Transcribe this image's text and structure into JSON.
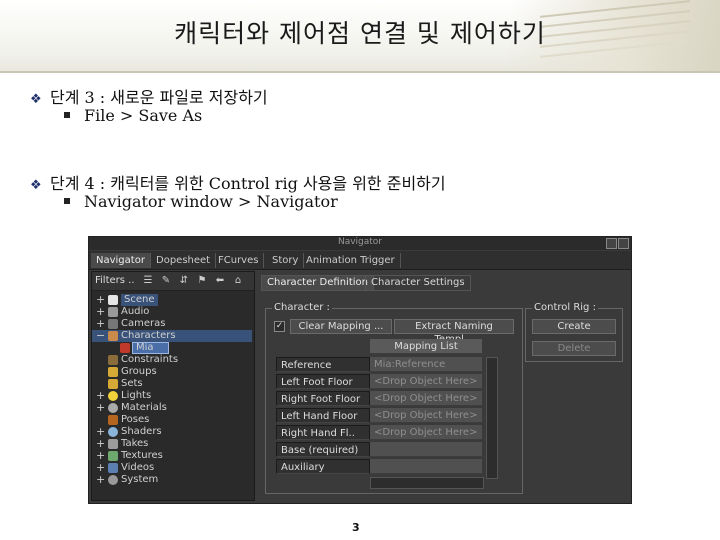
{
  "slide": {
    "title": "캐릭터와 제어점 연결 및 제어하기",
    "bullets": [
      {
        "text": "단계 3 : 새로운 파일로 저장하기",
        "sub": "File > Save As"
      },
      {
        "text": "단계 4 : 캐릭터를 위한 Control rig 사용을 위한 준비하기",
        "sub": "Navigator window > Navigator"
      }
    ],
    "page_number": "3"
  },
  "window": {
    "title": "Navigator",
    "tabs": [
      "Navigator",
      "Dopesheet",
      "FCurves",
      "Story",
      "Animation Trigger"
    ],
    "filters_label": "Filters ..",
    "tree": [
      {
        "label": "Scene",
        "expand": "+"
      },
      {
        "label": "Audio",
        "expand": "+"
      },
      {
        "label": "Cameras",
        "expand": "+"
      },
      {
        "label": "Characters",
        "expand": "−"
      },
      {
        "label": "Mia",
        "expand": ""
      },
      {
        "label": "Constraints",
        "expand": ""
      },
      {
        "label": "Groups",
        "expand": ""
      },
      {
        "label": "Sets",
        "expand": ""
      },
      {
        "label": "Lights",
        "expand": "+"
      },
      {
        "label": "Materials",
        "expand": "+"
      },
      {
        "label": "Poses",
        "expand": ""
      },
      {
        "label": "Shaders",
        "expand": "+"
      },
      {
        "label": "Takes",
        "expand": "+"
      },
      {
        "label": "Textures",
        "expand": "+"
      },
      {
        "label": "Videos",
        "expand": "+"
      },
      {
        "label": "System",
        "expand": "+"
      }
    ],
    "right_tabs": [
      "Character Definition",
      "Character Settings"
    ],
    "character_group": "Character :",
    "clear_mapping": "Clear Mapping ...",
    "extract_naming": "Extract Naming Templ...",
    "mapping_list_header": "Mapping List",
    "mapping_rows": [
      {
        "left": "Reference",
        "right": "Mia:Reference"
      },
      {
        "left": "Left Foot Floor",
        "right": "<Drop Object Here>"
      },
      {
        "left": "Right Foot Floor",
        "right": "<Drop Object Here>"
      },
      {
        "left": "Left Hand Floor",
        "right": "<Drop Object Here>"
      },
      {
        "left": "Right Hand Fl..",
        "right": "<Drop Object Here>"
      },
      {
        "left": "Base (required)",
        "right": ""
      },
      {
        "left": "Auxiliary",
        "right": ""
      }
    ],
    "control_rig_group": "Control Rig :",
    "create_label": "Create",
    "delete_label": "Delete"
  },
  "colors": {
    "selection": "#39527a",
    "diamond": "#1f2f6b"
  }
}
